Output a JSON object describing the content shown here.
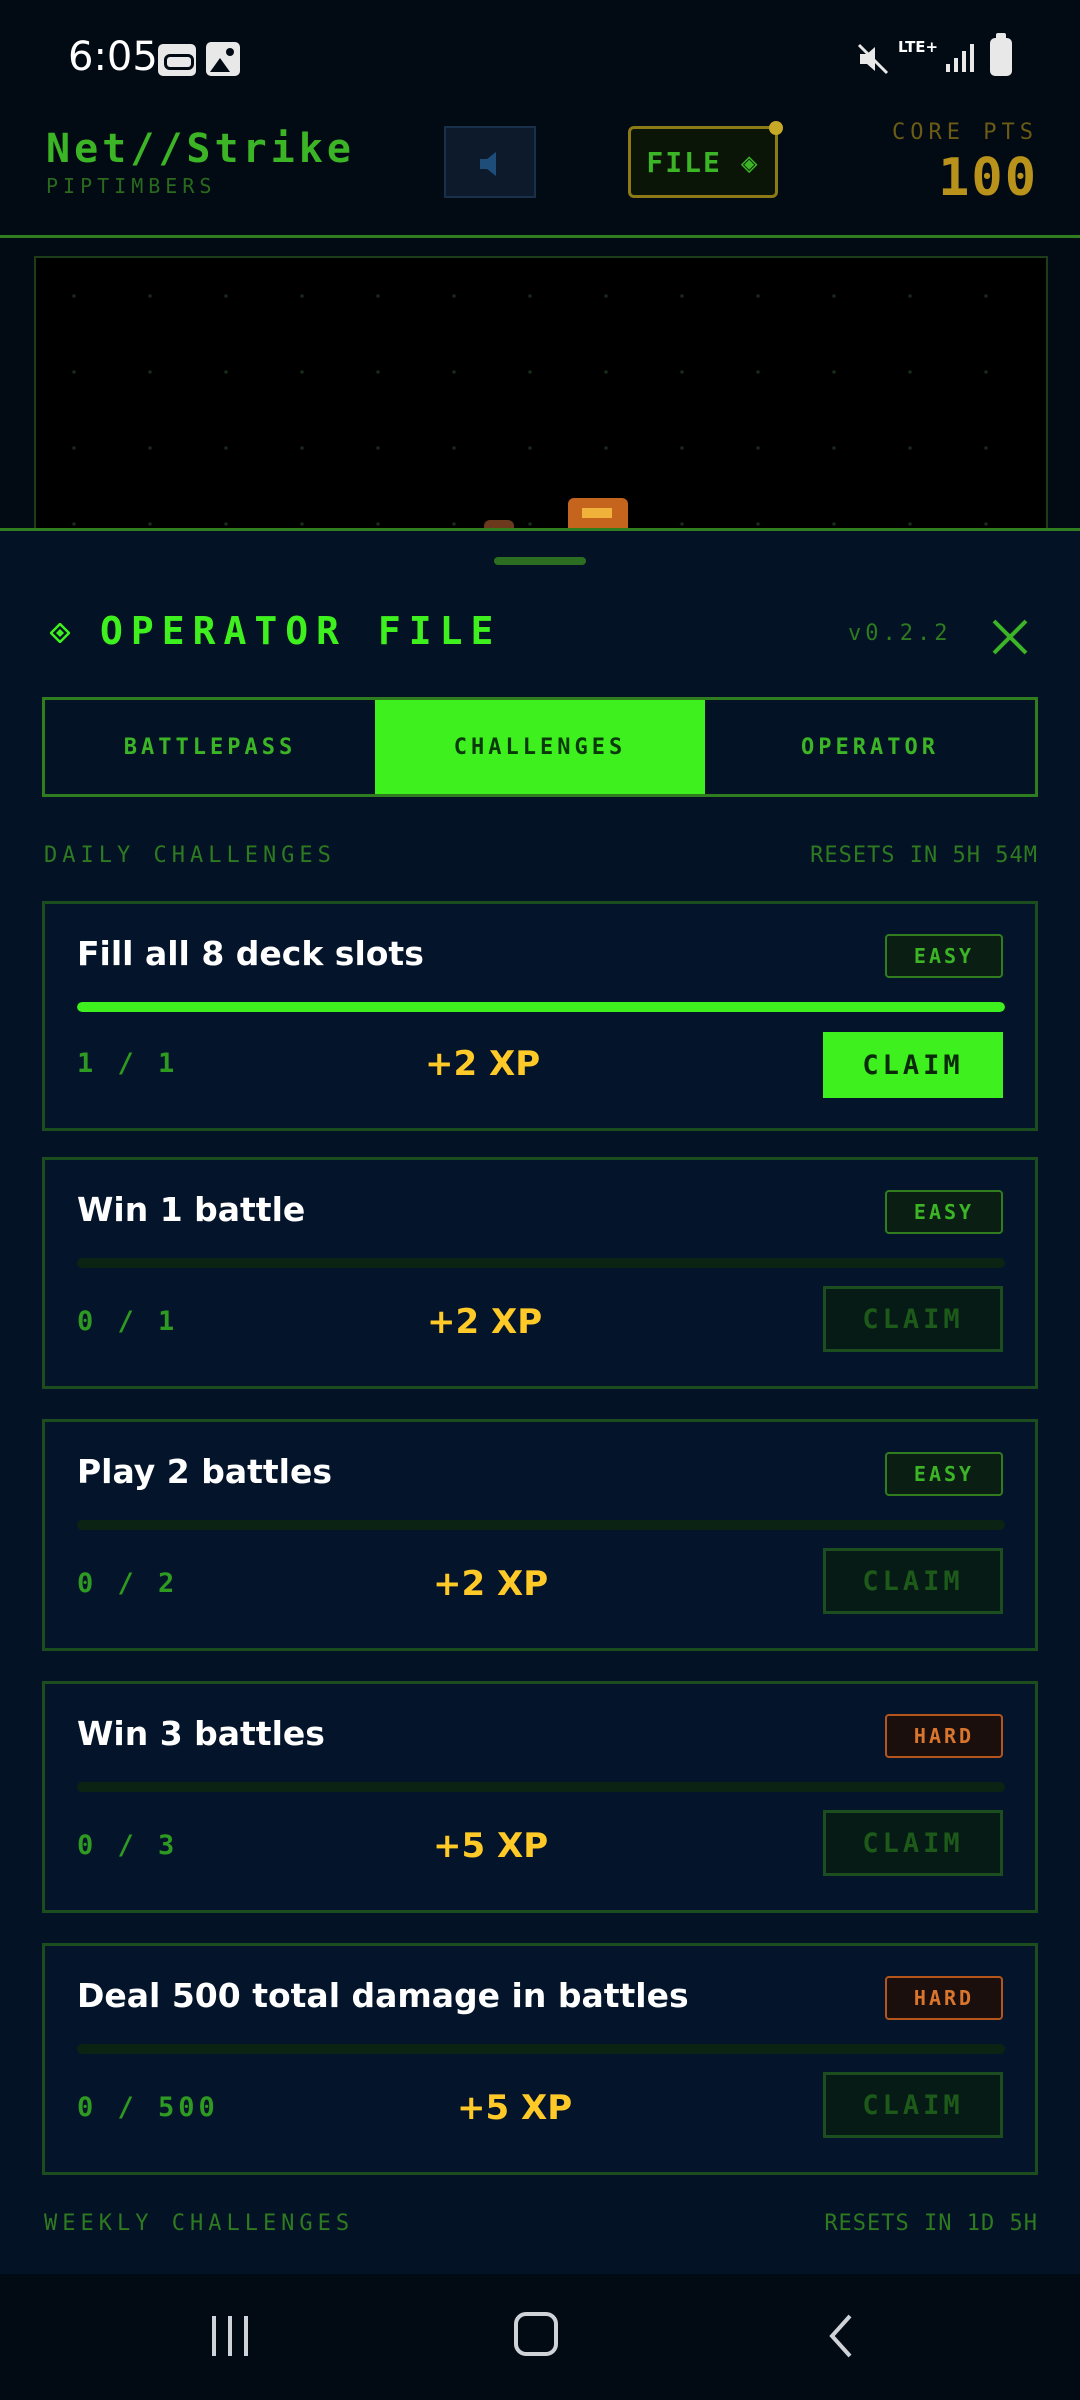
{
  "status_bar": {
    "time": "6:05",
    "network": "LTE+",
    "icons": [
      "voicemail-icon",
      "image-icon",
      "mute-icon",
      "signal-icon",
      "battery-icon"
    ]
  },
  "header": {
    "title": "Net//Strike",
    "subtitle": "PIPTIMBERS",
    "file_button": "FILE ◈",
    "core_label": "CORE PTS",
    "core_value": "100"
  },
  "sheet": {
    "title": "OPERATOR FILE",
    "version": "v0.2.2",
    "tabs": [
      {
        "label": "BATTLEPASS",
        "active": false
      },
      {
        "label": "CHALLENGES",
        "active": true
      },
      {
        "label": "OPERATOR",
        "active": false
      }
    ]
  },
  "daily": {
    "heading": "DAILY CHALLENGES",
    "reset": "RESETS IN 5H 54M",
    "challenges": [
      {
        "title": "Fill all 8 deck slots",
        "difficulty": "EASY",
        "progress_text": "1 / 1",
        "progress": 1.0,
        "reward": "+2 XP",
        "claim": "CLAIM",
        "claimable": true
      },
      {
        "title": "Win 1 battle",
        "difficulty": "EASY",
        "progress_text": "0 / 1",
        "progress": 0.0,
        "reward": "+2 XP",
        "claim": "CLAIM",
        "claimable": false
      },
      {
        "title": "Play 2 battles",
        "difficulty": "EASY",
        "progress_text": "0 / 2",
        "progress": 0.0,
        "reward": "+2 XP",
        "claim": "CLAIM",
        "claimable": false
      },
      {
        "title": "Win 3 battles",
        "difficulty": "HARD",
        "progress_text": "0 / 3",
        "progress": 0.0,
        "reward": "+5 XP",
        "claim": "CLAIM",
        "claimable": false
      },
      {
        "title": "Deal 500 total damage in battles",
        "difficulty": "HARD",
        "progress_text": "0 / 500",
        "progress": 0.0,
        "reward": "+5 XP",
        "claim": "CLAIM",
        "claimable": false
      }
    ]
  },
  "weekly": {
    "heading": "WEEKLY CHALLENGES",
    "reset": "RESETS IN 1D 5H"
  },
  "colors": {
    "accent": "#3ff01f",
    "reward": "#ffca28",
    "hard": "#d9752c",
    "background": "#031224"
  }
}
